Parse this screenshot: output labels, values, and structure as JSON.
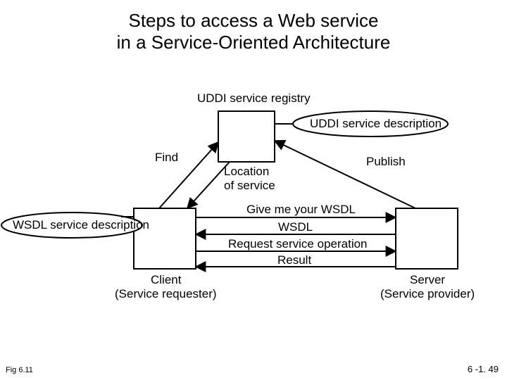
{
  "title_line1": "Steps to access a Web service",
  "title_line2": "in a Service-Oriented Architecture",
  "labels": {
    "uddi_registry": "UDDI service registry",
    "uddi_desc": "UDDI service description",
    "wsdl_desc": "WSDL service description",
    "find": "Find",
    "publish": "Publish",
    "location": "Location\nof service",
    "give_wsdl": "Give me your WSDL",
    "wsdl": "WSDL",
    "request_op": "Request service operation",
    "result": "Result",
    "client_title": "Client",
    "client_sub": "(Service requester)",
    "server_title": "Server",
    "server_sub": "(Service provider)"
  },
  "footer": {
    "fig": "Fig 6.11",
    "page": "6 -1. 49"
  },
  "chart_data": {
    "type": "diagram",
    "title": "Steps to access a Web service in a Service-Oriented Architecture",
    "nodes": [
      {
        "id": "registry",
        "label": "UDDI service registry",
        "attachment": "UDDI service description"
      },
      {
        "id": "client",
        "label": "Client",
        "sublabel": "Service requester",
        "attachment": "WSDL service description"
      },
      {
        "id": "server",
        "label": "Server",
        "sublabel": "Service provider"
      }
    ],
    "edges": [
      {
        "from": "client",
        "to": "registry",
        "label": "Find",
        "direction": "forward"
      },
      {
        "from": "registry",
        "to": "client",
        "label": "Location of service",
        "direction": "forward"
      },
      {
        "from": "server",
        "to": "registry",
        "label": "Publish",
        "direction": "forward"
      },
      {
        "from": "client",
        "to": "server",
        "label": "Give me your WSDL",
        "direction": "forward"
      },
      {
        "from": "server",
        "to": "client",
        "label": "WSDL",
        "direction": "forward"
      },
      {
        "from": "client",
        "to": "server",
        "label": "Request service operation",
        "direction": "forward"
      },
      {
        "from": "server",
        "to": "client",
        "label": "Result",
        "direction": "forward"
      }
    ]
  }
}
